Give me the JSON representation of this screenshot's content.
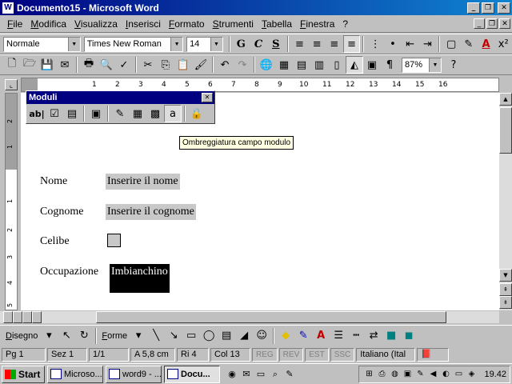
{
  "window": {
    "title": "Documento15 - Microsoft Word",
    "controls": [
      "_",
      "❐",
      "✕"
    ]
  },
  "menu": [
    "File",
    "Modifica",
    "Visualizza",
    "Inserisci",
    "Formato",
    "Strumenti",
    "Tabella",
    "Finestra",
    "?"
  ],
  "formatting": {
    "style": "Normale",
    "font": "Times New Roman",
    "size": "14",
    "bold": "G",
    "italic": "C",
    "underline": "S"
  },
  "standard": {
    "zoom": "87%"
  },
  "ruler": {
    "ticks": [
      "1",
      "2",
      "3",
      "4",
      "5",
      "6",
      "7",
      "8",
      "9",
      "10",
      "11",
      "12",
      "13",
      "14",
      "15",
      "16"
    ],
    "vticks": [
      "2",
      "1",
      "1",
      "2",
      "3",
      "4",
      "5"
    ]
  },
  "forms_toolbar": {
    "title": "Moduli",
    "text_field": "ab|"
  },
  "tooltip": "Ombreggiatura campo modulo",
  "form": {
    "name_label": "Nome",
    "name_value": "Inserire il nome",
    "surname_label": "Cognome",
    "surname_value": "Inserire il cognome",
    "single_label": "Celibe",
    "job_label": "Occupazione",
    "job_value": "Imbianchino"
  },
  "drawing": {
    "draw_label": "Disegno",
    "autoshapes_label": "Forme"
  },
  "status": {
    "page": "Pg 1",
    "section": "Sez 1",
    "pages": "1/1",
    "at": "A 5,8 cm",
    "line": "Ri 4",
    "column": "Col 13",
    "rec": "REG",
    "rev": "REV",
    "ext": "EST",
    "ovr": "SSC",
    "language": "Italiano (Ital"
  },
  "taskbar": {
    "start": "Start",
    "tasks": [
      "Microso...",
      "word9 - ...",
      "Docu..."
    ],
    "clock": "19.42"
  },
  "colors": {
    "title_bar": "#000080",
    "field_shading": "#c8c8c8"
  }
}
